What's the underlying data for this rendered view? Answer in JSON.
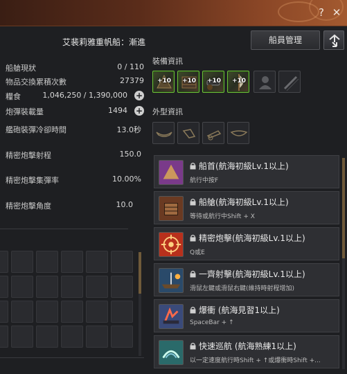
{
  "titlebar": {
    "help_label": "?",
    "close_label": "✕"
  },
  "ship": {
    "name": "艾裴莉雅重帆船：漸進"
  },
  "buttons": {
    "crew": "船員管理"
  },
  "stats": [
    {
      "label": "船艙現狀",
      "value": "0 / 110"
    },
    {
      "label": "物品交換累積次數",
      "value": "27379"
    },
    {
      "label": "糧食",
      "value": "1,046,250 / 1,390,000"
    },
    {
      "label": "炮彈裝載量",
      "value": "1494"
    },
    {
      "label": "艦砲裝彈冷卻時間",
      "value": "13.0秒"
    },
    {
      "label": "精密炮擊射程",
      "value": "150.0"
    },
    {
      "label": "精密炮擊集彈率",
      "value": "10.00%"
    },
    {
      "label": "精密炮擊角度",
      "value": "10.0"
    }
  ],
  "plus_label": "+",
  "sections": {
    "equipment": "裝備資訊",
    "appearance": "外型資訊"
  },
  "equipment": [
    {
      "enhance": "+10",
      "icon": "ship-bow-ornament-icon"
    },
    {
      "enhance": "+10",
      "icon": "ship-plating-icon"
    },
    {
      "enhance": "+10",
      "icon": "ship-cannon-icon"
    },
    {
      "enhance": "+10",
      "icon": "ship-sail-icon"
    },
    {
      "enhance": "",
      "icon": "sailor-silhouette-icon"
    },
    {
      "enhance": "",
      "icon": "spyglass-icon"
    }
  ],
  "appearance": [
    {
      "icon": "bow-outline-icon"
    },
    {
      "icon": "plating-outline-icon"
    },
    {
      "icon": "cannon-outline-icon"
    },
    {
      "icon": "sail-outline-icon"
    }
  ],
  "skills": [
    {
      "name": "船首(航海初級Lv.1以上)",
      "desc": "航行中按F",
      "icon": "bow-ram-skill-icon",
      "color": "#7a3a8a"
    },
    {
      "name": "船艙(航海初級Lv.1以上)",
      "desc": "等待或航行中Shift + X",
      "icon": "cargo-hold-skill-icon",
      "color": "#6a3a22"
    },
    {
      "name": "精密炮擊(航海初級Lv.1以上)",
      "desc": "Q或E",
      "icon": "crosshair-skill-icon",
      "color": "#b8301c"
    },
    {
      "name": "一齊射擊(航海初級Lv.1以上)",
      "desc": "滑鼠左鍵或滑鼠右鍵(維持時射程增加)",
      "icon": "broadside-skill-icon",
      "color": "#2a4a6a"
    },
    {
      "name": "爆衝 (航海見習1以上)",
      "desc": "SpaceBar + ↑",
      "icon": "boost-skill-icon",
      "color": "#3a4a7a"
    },
    {
      "name": "快速巡航 (航海熟練1以上)",
      "desc": "以一定速度航行時Shift + ↑或爆衝時Shift +...",
      "icon": "cruise-skill-icon",
      "color": "#2a6a6a"
    }
  ]
}
